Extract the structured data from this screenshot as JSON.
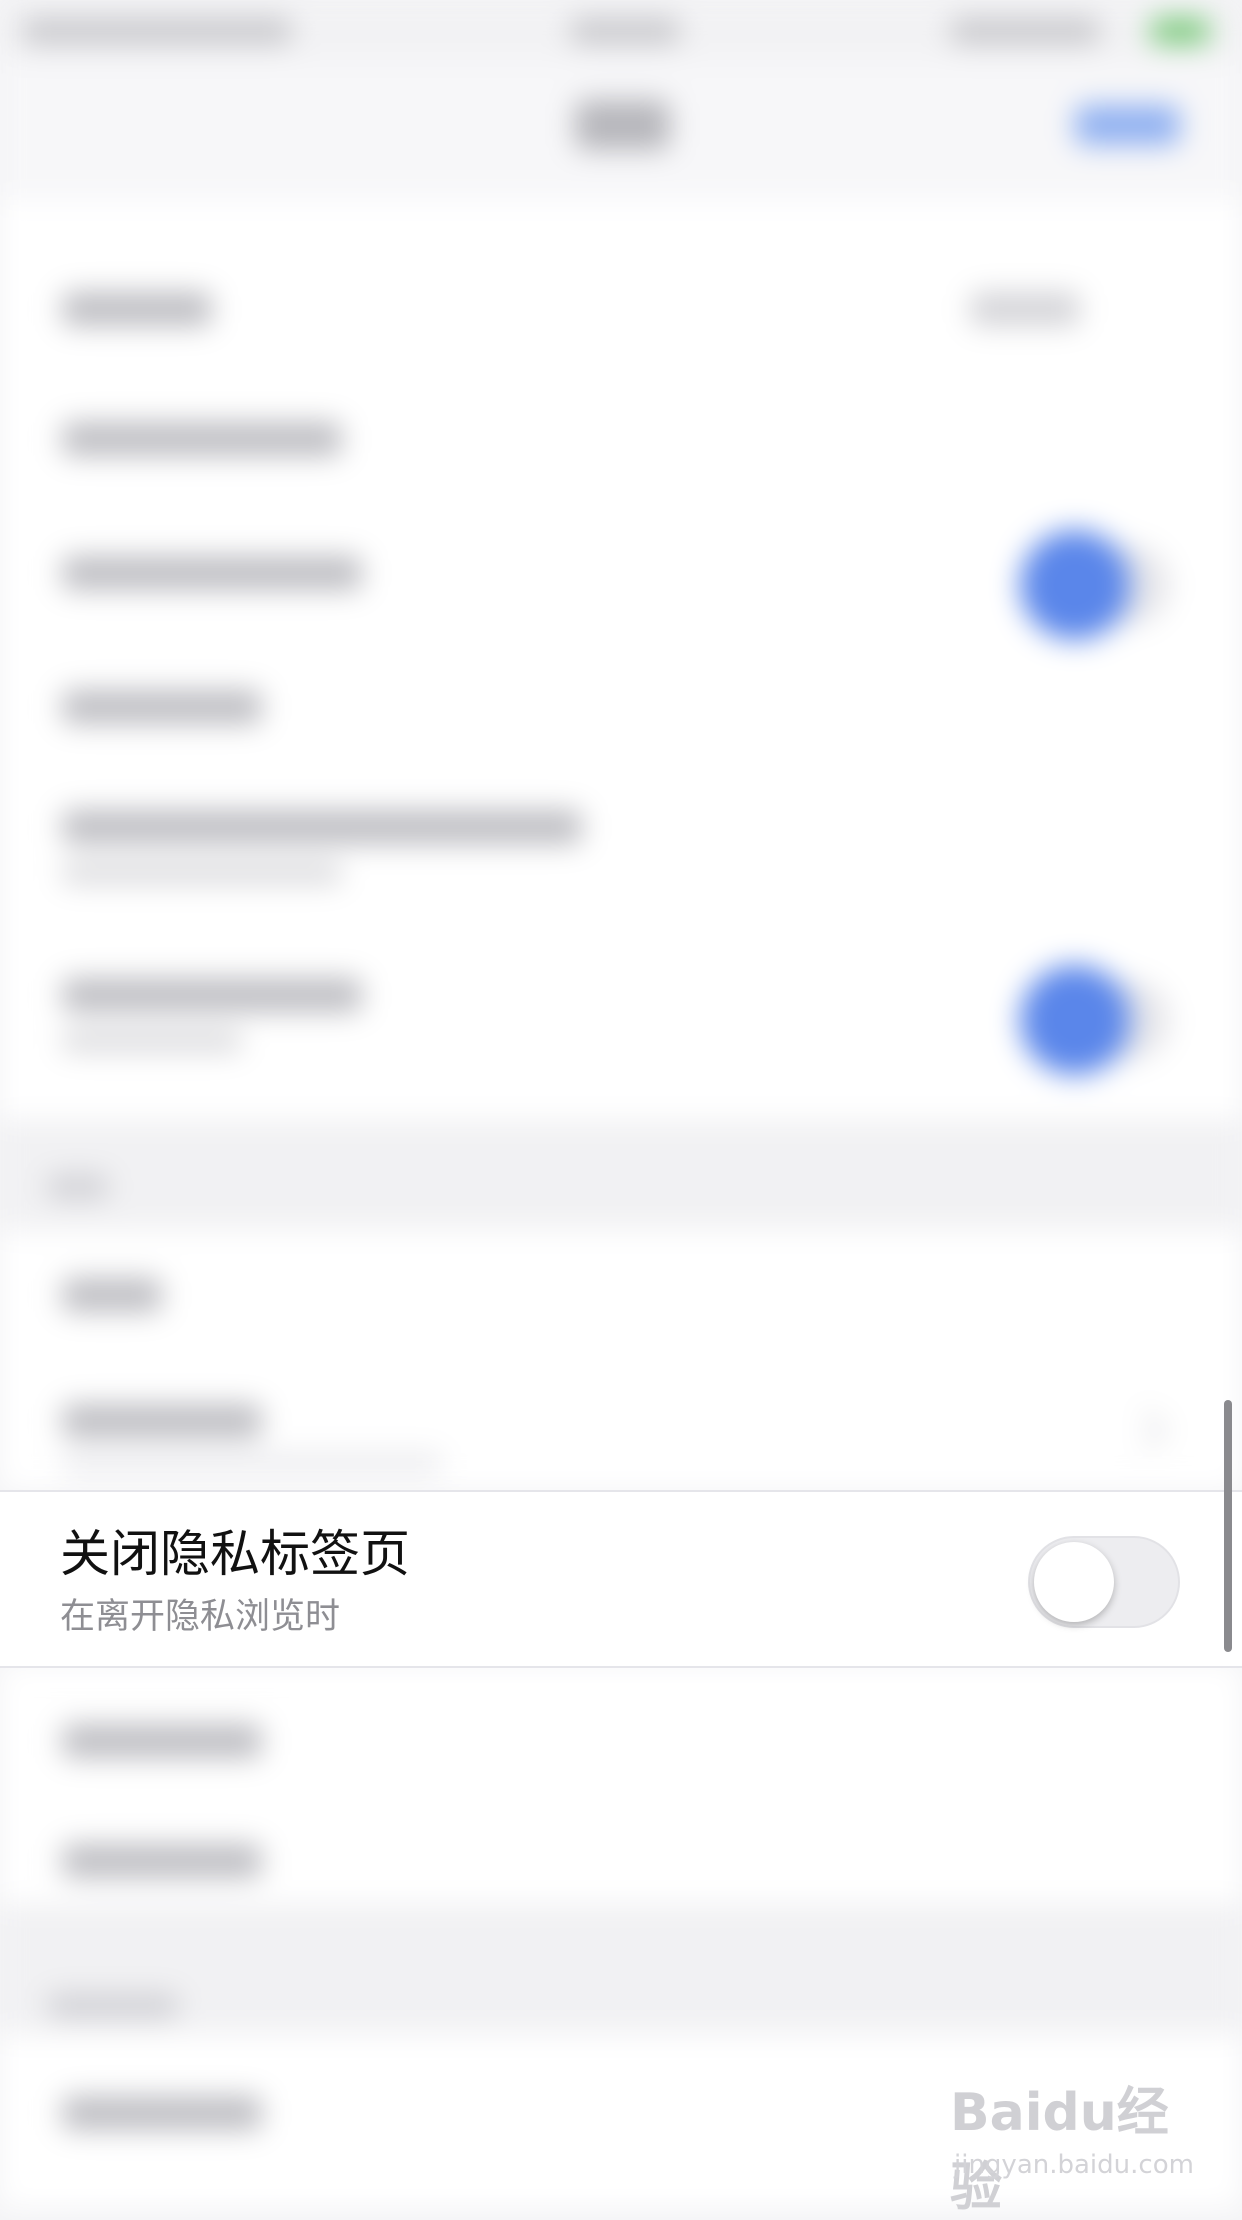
{
  "focused_row": {
    "title": "关闭隐私标签页",
    "subtitle": "在离开隐私浏览时",
    "toggle_state": "off"
  },
  "watermark": {
    "logo": "Baidu经验",
    "url": "jingyan.baidu.com"
  },
  "colors": {
    "accent": "#5a86ea",
    "background": "#f4f4f6",
    "row_background": "#ffffff"
  },
  "icons": [
    "chevron-right-icon",
    "toggle-switch"
  ]
}
